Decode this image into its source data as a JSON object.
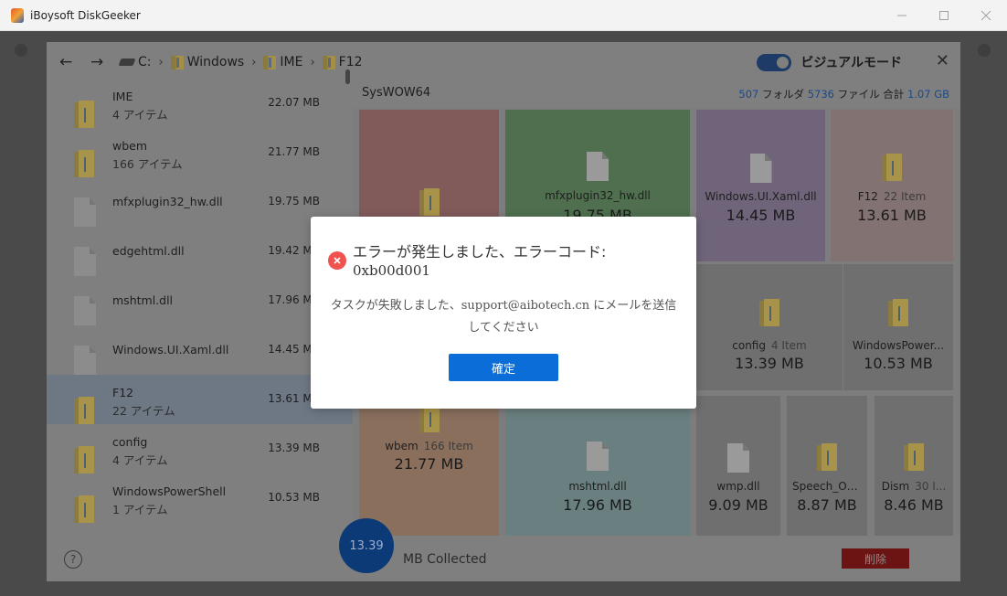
{
  "app": {
    "title": "iBoysoft DiskGeeker"
  },
  "window_controls": {
    "minimize": "—",
    "maximize": "☐",
    "close": "✕"
  },
  "nav": {
    "back": "←",
    "forward": "→",
    "breadcrumbs": [
      {
        "label": "C:",
        "icon": "drive-icon"
      },
      {
        "label": "Windows",
        "icon": "folder-icon"
      },
      {
        "label": "IME",
        "icon": "folder-icon"
      },
      {
        "label": "F12",
        "icon": "folder-icon"
      }
    ],
    "separator": "›"
  },
  "visual_mode": {
    "label": "ビジュアルモード",
    "enabled": true
  },
  "close_panel": "✕",
  "list": {
    "rows": [
      {
        "name": "IME",
        "sub": "4 アイテム",
        "size": "22.07 MB",
        "type": "folder",
        "selected": false
      },
      {
        "name": "wbem",
        "sub": "166 アイテム",
        "size": "21.77 MB",
        "type": "folder",
        "selected": false
      },
      {
        "name": "mfxplugin32_hw.dll",
        "sub": "",
        "size": "19.75 MB",
        "type": "file",
        "selected": false
      },
      {
        "name": "edgehtml.dll",
        "sub": "",
        "size": "19.42 MB",
        "type": "file",
        "selected": false
      },
      {
        "name": "mshtml.dll",
        "sub": "",
        "size": "17.96 MB",
        "type": "file",
        "selected": false
      },
      {
        "name": "Windows.UI.Xaml.dll",
        "sub": "",
        "size": "14.45 MB",
        "type": "file",
        "selected": false
      },
      {
        "name": "F12",
        "sub": "22 アイテム",
        "size": "13.61 MB",
        "type": "folder",
        "selected": true
      },
      {
        "name": "config",
        "sub": "4 アイテム",
        "size": "13.39 MB",
        "type": "folder",
        "selected": false
      },
      {
        "name": "WindowsPowerShell",
        "sub": "1 アイテム",
        "size": "10.53 MB",
        "type": "folder",
        "selected": false
      }
    ]
  },
  "treemap": {
    "folder_name": "SysWOW64",
    "stats": {
      "folders": "507",
      "folders_label": "フォルダ",
      "files": "5736",
      "files_label": "ファイル",
      "total_label": "合計",
      "total": "1.07 GB"
    },
    "tiles": [
      {
        "name": "mfxplugin32_hw.dll",
        "items": "",
        "size": "19.75 MB",
        "type": "file",
        "color": "#4f6f4f"
      },
      {
        "name": "Windows.UI.Xaml.dll",
        "items": "",
        "size": "14.45 MB",
        "type": "file",
        "color": "#6f6479"
      },
      {
        "name": "F12",
        "items": "22 Item",
        "size": "13.61 MB",
        "type": "folder",
        "color": "#827272"
      },
      {
        "name": "config",
        "items": "4 Item",
        "size": "13.39 MB",
        "type": "folder",
        "color": "#6f6f6f"
      },
      {
        "name": "WindowsPower...",
        "items": "",
        "size": "10.53 MB",
        "type": "folder",
        "color": "#6f6f6f"
      },
      {
        "name": "wbem",
        "items": "166 Item",
        "size": "21.77 MB",
        "type": "folder",
        "color": "#8a6f5d"
      },
      {
        "name": "mshtml.dll",
        "items": "",
        "size": "17.96 MB",
        "type": "file",
        "color": "#6a8080"
      },
      {
        "name": "wmp.dll",
        "items": "",
        "size": "9.09 MB",
        "type": "file",
        "color": "#6f6f6f"
      },
      {
        "name": "Speech_On...",
        "items": "",
        "size": "8.87 MB",
        "type": "folder",
        "color": "#6f6f6f"
      },
      {
        "name": "Dism",
        "items": "30 I...",
        "size": "8.46 MB",
        "type": "folder",
        "color": "#6f6f6f"
      },
      {
        "name": "",
        "items": "",
        "size": "",
        "type": "folder",
        "color": "#815a5a"
      },
      {
        "name": "",
        "items": "",
        "size": "",
        "type": "none",
        "color": "#6f6f6f"
      }
    ]
  },
  "bottom": {
    "help": "?",
    "collected_value": "13.39",
    "collected_label": "MB Collected",
    "delete_label": "削除"
  },
  "dialog": {
    "title": "エラーが発生しました、エラーコード:",
    "code": "0xb00d001",
    "message_part1": "タスクが失敗しました、",
    "email": "support@aibotech.cn",
    "message_part2": " にメールを送信してください",
    "ok_label": "確定",
    "error_icon_color": "#f0534f",
    "button_color": "#0a6dd8"
  }
}
